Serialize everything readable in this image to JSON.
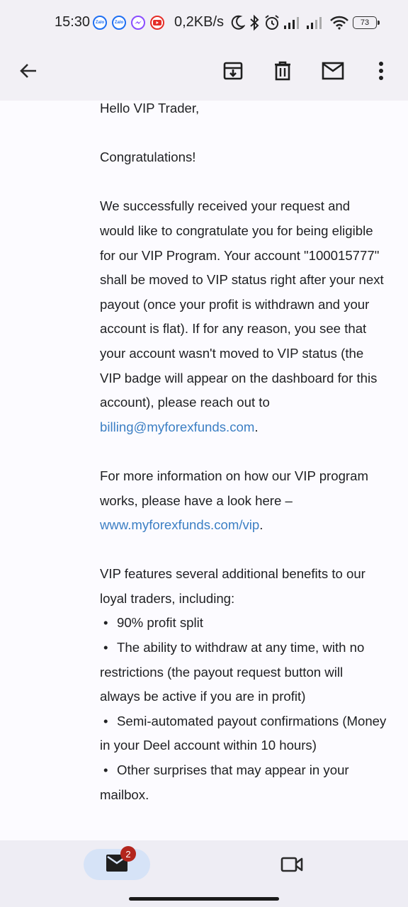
{
  "status_bar": {
    "time": "15:30",
    "app_icons": [
      "Zalo",
      "Zalo",
      "messenger-icon",
      "youtube-icon"
    ],
    "network_speed": "0,2KB/s",
    "battery": "73"
  },
  "toolbar": {
    "icons": [
      "back-arrow-icon",
      "archive-icon",
      "delete-icon",
      "mark-unread-icon",
      "more-vert-icon"
    ]
  },
  "email": {
    "greeting": "Hello VIP Trader,",
    "congrats": "Congratulations!",
    "para1": "We successfully received your request and would like to congratulate you for being eligible for our VIP Program. Your account \"100015777\" shall be moved to VIP status right after your next payout (once your profit is withdrawn and your account is flat). If for any reason, you see that your account wasn't moved to VIP status (the VIP badge will appear on the dashboard for this account), please reach out to",
    "billing_email": "billing@myforexfunds.com",
    "para2": "For more information on how our VIP program works, please have a look here –",
    "vip_link": "www.myforexfunds.com/vip",
    "para3": "VIP features several additional benefits to our loyal traders, including:",
    "bullets": [
      "90% profit split",
      "The ability to withdraw at any time, with no restrictions (the payout request button will always be active if you are in profit)",
      "Semi-automated payout confirmations (Money in your Deel account within 10 hours)",
      "Other surprises that may appear in your mailbox."
    ],
    "bullet_char": "•",
    "period": "."
  },
  "bottom_nav": {
    "mail_badge": "2"
  },
  "colors": {
    "link": "#3c7fc4",
    "badge": "#b3261e",
    "nav_active": "#d6e3f7"
  }
}
